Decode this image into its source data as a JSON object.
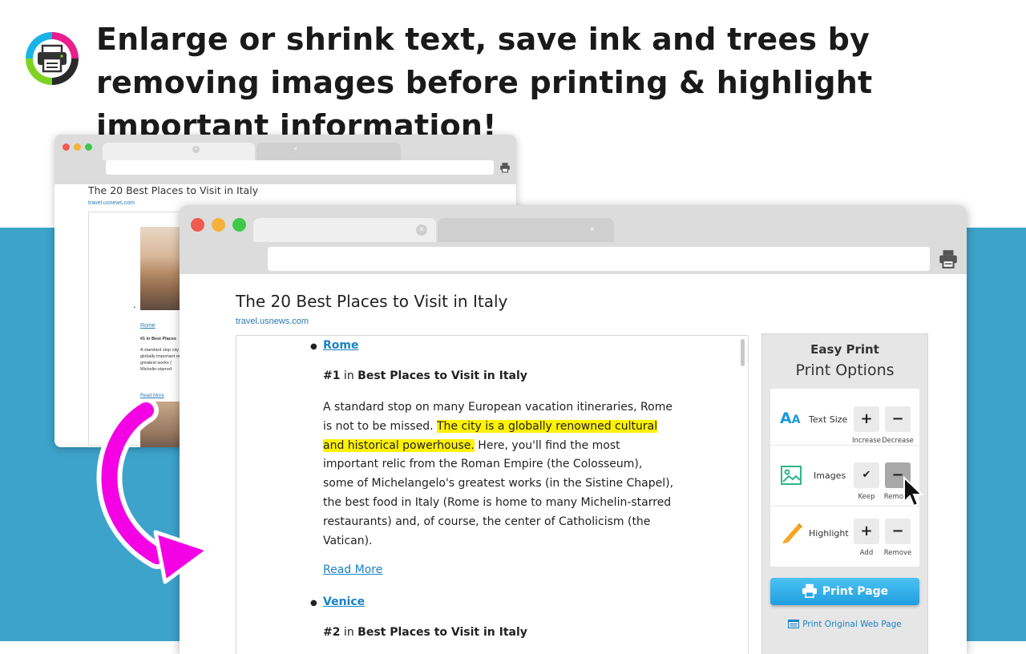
{
  "headline": "Enlarge or shrink text, save ink and trees by removing images before printing & highlight important information!",
  "colors": {
    "accent_blue": "#3da3cb",
    "link": "#1a82c4",
    "highlight": "#fff200",
    "magenta_arrow": "#f400e4",
    "pencil": "#f5a623"
  },
  "icons": {
    "logo": "printer-logo-icon",
    "browser_print": "printer-icon",
    "text_size": "text-size-icon",
    "images": "image-icon",
    "highlight": "pencil-icon"
  },
  "back_window": {
    "page_title": "The 20 Best Places to Visit in Italy",
    "page_url": "travel.usnews.com",
    "item_link": "Rome",
    "item_rank": "#1 in Best Places",
    "item_text": "A standard stop city is a globally important relic greatest works ( Michelin-starred",
    "read_more": "Read More"
  },
  "front_window": {
    "page_title": "The 20 Best Places to Visit in Italy",
    "page_url": "travel.usnews.com",
    "items": [
      {
        "link": "Rome",
        "rank_prefix": "#1",
        "rank_in": " in ",
        "rank_list": "Best Places to Visit in Italy",
        "text_before": "A standard stop on many European vacation itineraries, Rome is not to be missed. ",
        "text_highlight": "The city is a globally renowned cultural and historical powerhouse.",
        "text_after": " Here, you'll find the most important relic from the Roman Empire (the Colosseum), some of Michelangelo's greatest works (in the Sistine Chapel), the best food in Italy (Rome is home to many Michelin-starred restaurants) and, of course, the center of Catholicism (the Vatican).",
        "read_more": "Read More"
      },
      {
        "link": "Venice",
        "rank_prefix": "#2",
        "rank_in": " in ",
        "rank_list": "Best Places to Visit in Italy"
      }
    ]
  },
  "panel": {
    "brand": "Easy Print",
    "title": "Print Options",
    "options": [
      {
        "label": "Text Size",
        "icon_text": "AA",
        "btn1": "+",
        "btn1_caption": "Increase",
        "btn2": "−",
        "btn2_caption": "Decrease"
      },
      {
        "label": "Images",
        "btn1": "✔",
        "btn1_caption": "Keep",
        "btn2": "−",
        "btn2_caption": "Remove"
      },
      {
        "label": "Highlight",
        "btn1": "+",
        "btn1_caption": "Add",
        "btn2": "−",
        "btn2_caption": "Remove"
      }
    ],
    "print_button": "Print Page",
    "original_link": "Print Original Web Page"
  }
}
